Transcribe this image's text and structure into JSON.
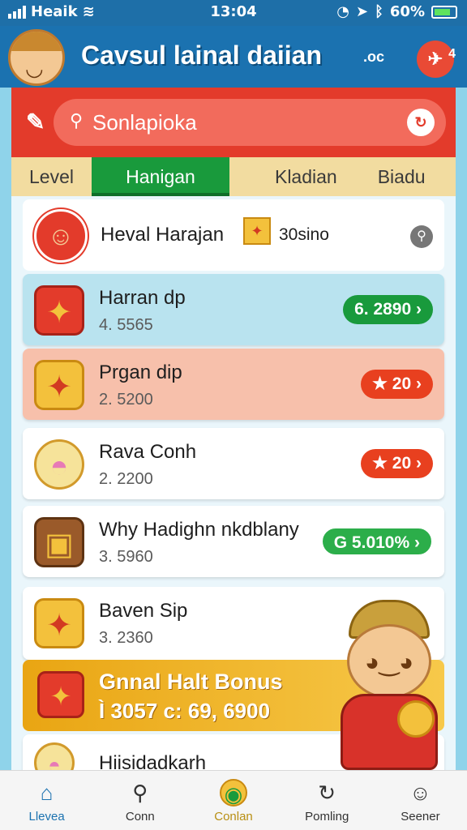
{
  "status_bar": {
    "carrier": "Heaik",
    "time": "13:04",
    "battery": "60%"
  },
  "header": {
    "title": "Cavsul lainal daiian",
    "doc_label": ".oc",
    "notification_count": "4"
  },
  "search": {
    "placeholder": "Sonlapioka"
  },
  "tabs": [
    {
      "label": "Level"
    },
    {
      "label": "Hanigan",
      "active": true
    },
    {
      "label": "Kladian"
    },
    {
      "label": "Biadu"
    }
  ],
  "user": {
    "name": "Heval Harajan",
    "coins": "30sino"
  },
  "rows": [
    {
      "name": "Harran dp",
      "value": "4. 5565",
      "pill": "6. 2890  ›",
      "style": "blue",
      "icon": "red-gift-icon"
    },
    {
      "name": "Prgan dip",
      "value": "2. 5200",
      "pill": "★ 20  ›",
      "style": "peach",
      "icon": "yellow-gift-icon"
    },
    {
      "name": "Rava Conh",
      "value": "2. 2200",
      "pill": "★ 20  ›",
      "style": "white",
      "icon": "bowl-icon"
    },
    {
      "name": "Why Hadighn nkdblany",
      "value": "3. 5960",
      "pill": "G 5.010%  ›",
      "style": "white",
      "icon": "chest-icon"
    },
    {
      "name": "Baven Sip",
      "value": "3. 2360",
      "pill": "",
      "style": "white",
      "icon": "yellow-gift-icon"
    }
  ],
  "bonus": {
    "title": "Gnnal Halt Bonus",
    "value": "Ì 3057 c: 69, 6900"
  },
  "partial_row": {
    "name": "Hiisidadkarh"
  },
  "bottom_tabs": [
    {
      "label": "Llevea",
      "icon": "home-icon",
      "active": true
    },
    {
      "label": "Conn",
      "icon": "search-icon"
    },
    {
      "label": "Conlan",
      "icon": "coin-icon",
      "center": true
    },
    {
      "label": "Pomling",
      "icon": "cycle-icon"
    },
    {
      "label": "Seener",
      "icon": "profile-icon"
    }
  ],
  "colors": {
    "header_blue": "#1b72b0",
    "search_red": "#e33b2b",
    "tab_green": "#199a3c",
    "bonus_gold": "#e9a513"
  }
}
